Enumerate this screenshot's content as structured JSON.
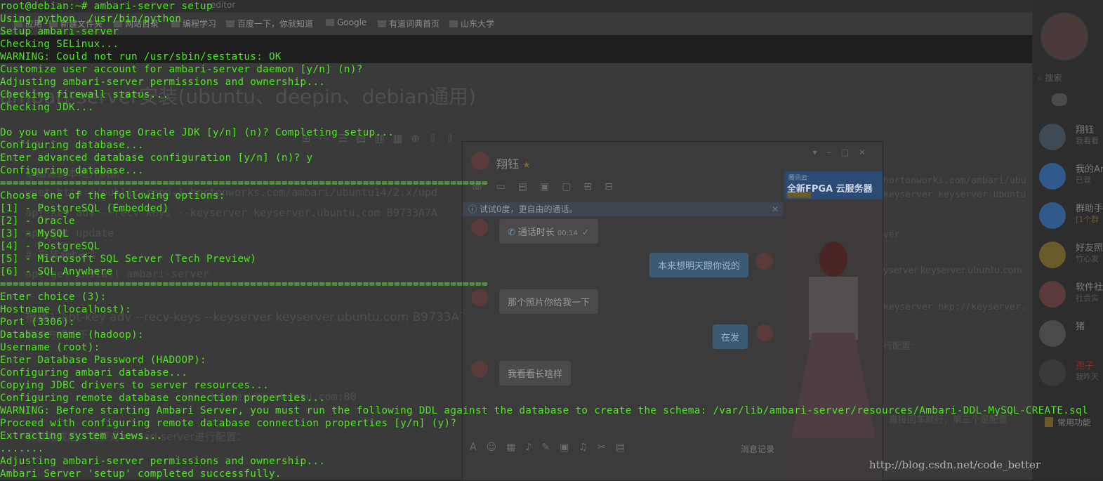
{
  "editor": {
    "tab_title": "editor",
    "bookmarks": [
      "应用",
      "新建文件夹",
      "网站目录",
      "编程学习",
      "百度一下，你就知道",
      "Google",
      "有道词典首页",
      "山东大学"
    ],
    "article_title": "ambari-server安装(ubuntu、deepin、debian通用)",
    "body_lines": [
      "添加源到本地并刷新",
      "wget http://public-repo-1.hortonworks.com/ambari/ubuntu14/2.x/upd",
      "apt-key adv --recv-keys --keyserver keyserver.ubuntu.com B9733A7A",
      "apt-get update",
      "# 安装ambari",
      "apt-get install ambari-server",
      "报错：apt-key adv --recv-keys --keyserver keyserver.ubuntu.com B9733A7",
      "解决方式如下：",
      "keyserver.ubuntu.com:80",
      "安装完成后，需要对ambari-server进行配置："
    ],
    "right_lines": [
      "hortonworks.com/ambari/ubu",
      "keyserver keyserver.ubuntu",
      "ver",
      "yserver keyserver.ubuntu.com",
      "keyserver hkp://keyserver.",
      "行配置:",
      "置，直接回车就行，第三个是配置"
    ]
  },
  "qq": {
    "search_placeholder": "搜索",
    "contacts": [
      {
        "name": "翔钰",
        "sub": "我看看"
      },
      {
        "name": "我的An",
        "sub": "已登"
      },
      {
        "name": "群助手",
        "sub": "[1个群"
      },
      {
        "name": "好友照",
        "sub": "竹心发"
      },
      {
        "name": "软件社",
        "sub": "社会实"
      },
      {
        "name": "猪",
        "sub": ""
      },
      {
        "name": "孢子",
        "sub": "我昨天"
      }
    ],
    "common_features": "常用功能"
  },
  "chat": {
    "contact_name": "翔钰",
    "notice": "试试0度，更自由的通话。",
    "call_label": "通话时长",
    "call_duration": "00:14",
    "messages": [
      {
        "from": "me",
        "text": "本来想明天跟你说的"
      },
      {
        "from": "them",
        "text": "那个照片你给我一下"
      },
      {
        "from": "me",
        "text": "在发"
      },
      {
        "from": "them",
        "text": "我看看长啥样"
      }
    ],
    "history_label": "消息记录",
    "ad_small": "腾讯云",
    "ad_title": "全新FPGA 云服务器"
  },
  "terminal": {
    "lines": [
      "root@debian:~# ambari-server setup",
      "Using python  /usr/bin/python",
      "Setup ambari-server",
      "Checking SELinux...",
      "WARNING: Could not run /usr/sbin/sestatus: OK",
      "Customize user account for ambari-server daemon [y/n] (n)?",
      "Adjusting ambari-server permissions and ownership...",
      "Checking firewall status...",
      "Checking JDK...",
      "",
      "Do you want to change Oracle JDK [y/n] (n)? Completing setup...",
      "Configuring database...",
      "Enter advanced database configuration [y/n] (n)? y",
      "Configuring database...",
      "==============================================================================",
      "Choose one of the following options:",
      "[1] - PostgreSQL (Embedded)",
      "[2] - Oracle",
      "[3] - MySQL",
      "[4] - PostgreSQL",
      "[5] - Microsoft SQL Server (Tech Preview)",
      "[6] - SQL Anywhere",
      "==============================================================================",
      "Enter choice (3):",
      "Hostname (localhost):",
      "Port (3306):",
      "Database name (hadoop):",
      "Username (root):",
      "Enter Database Password (HADOOP):",
      "Configuring ambari database...",
      "Copying JDBC drivers to server resources...",
      "Configuring remote database connection properties...",
      "WARNING: Before starting Ambari Server, you must run the following DDL against the database to create the schema: /var/lib/ambari-server/resources/Ambari-DDL-MySQL-CREATE.sql",
      "Proceed with configuring remote database connection properties [y/n] (y)?",
      "Extracting system views...",
      ".......",
      "Adjusting ambari-server permissions and ownership...",
      "Ambari Server 'setup' completed successfully."
    ]
  },
  "watermark": "http://blog.csdn.net/code_better",
  "colors": {
    "terminal_text": "#4ee61f",
    "chat_me_bubble": "#3b5a74"
  }
}
